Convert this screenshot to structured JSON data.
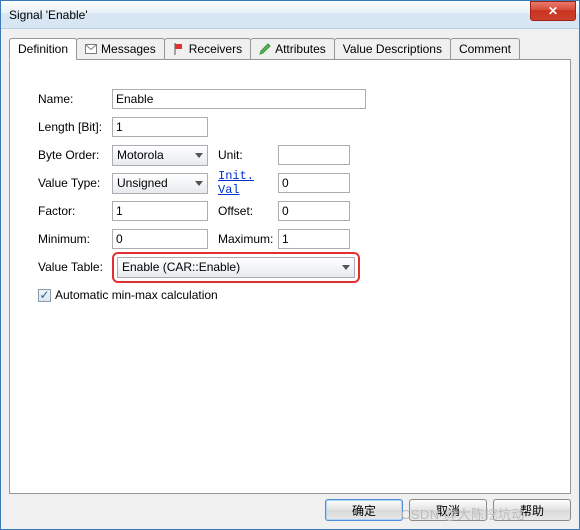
{
  "window": {
    "title": "Signal 'Enable'",
    "close_glyph": "✕"
  },
  "tabs": {
    "definition": "Definition",
    "messages": "Messages",
    "receivers": "Receivers",
    "attributes": "Attributes",
    "value_descriptions": "Value Descriptions",
    "comment": "Comment"
  },
  "labels": {
    "name": "Name:",
    "length": "Length [Bit]:",
    "byte_order": "Byte Order:",
    "unit": "Unit:",
    "value_type": "Value Type:",
    "init_val": "Init. Val",
    "factor": "Factor:",
    "offset": "Offset:",
    "minimum": "Minimum:",
    "maximum": "Maximum:",
    "value_table": "Value Table:",
    "auto_minmax": "Automatic min-max calculation"
  },
  "values": {
    "name": "Enable",
    "length": "1",
    "byte_order": "Motorola",
    "unit": "",
    "value_type": "Unsigned",
    "init_val": "0",
    "factor": "1",
    "offset": "0",
    "minimum": "0",
    "maximum": "1",
    "value_table": "Enable (CAR::Enable)",
    "auto_minmax_checked": "✓"
  },
  "buttons": {
    "ok": "确定",
    "cancel": "取消",
    "help": "帮助"
  },
  "watermark": "CSDN @大陈挖坑动"
}
